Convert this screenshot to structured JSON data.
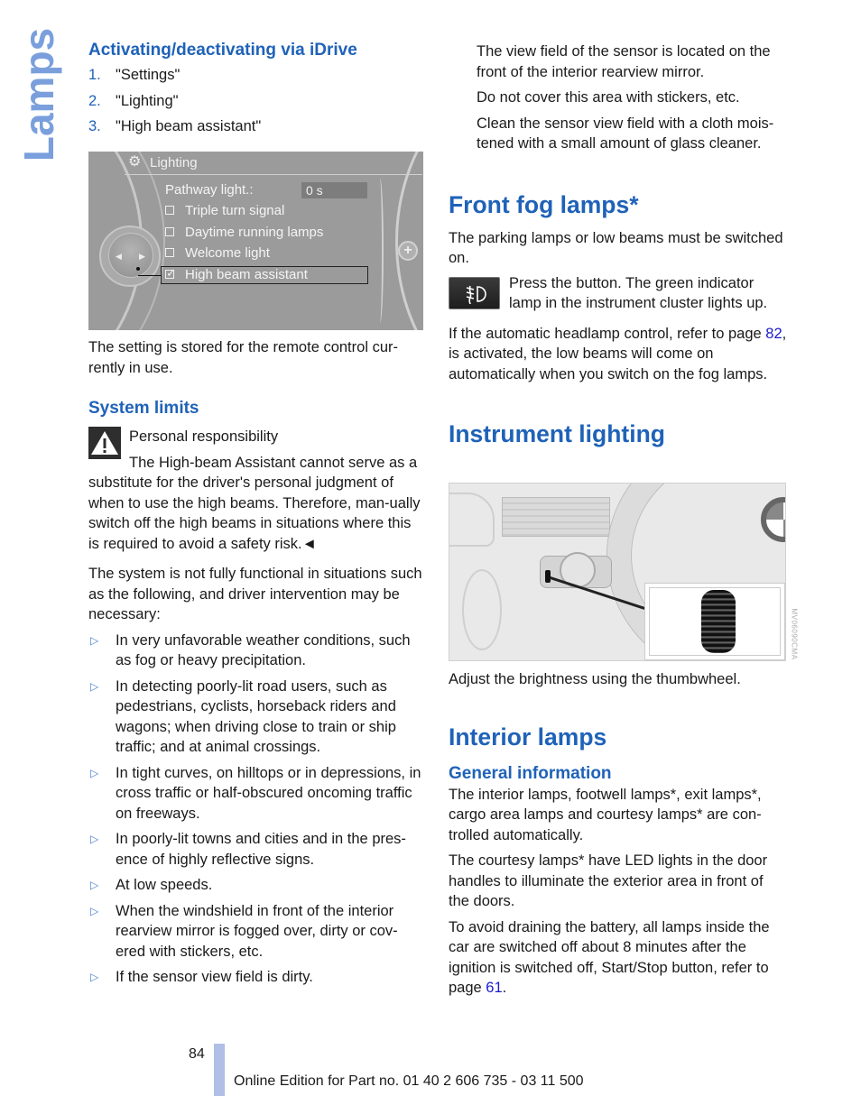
{
  "side_title": "Lamps",
  "left": {
    "idrive_heading": "Activating/deactivating via iDrive",
    "steps": [
      {
        "n": "1.",
        "text": "\"Settings\""
      },
      {
        "n": "2.",
        "text": "\"Lighting\""
      },
      {
        "n": "3.",
        "text": "\"High beam assistant\""
      }
    ],
    "idrive_screen": {
      "title": "Lighting",
      "title_icon": "settings-gear-icon",
      "pathway_label": "Pathway light.:",
      "pathway_value": "0 s",
      "options": [
        {
          "label": "Triple turn signal",
          "checked": false
        },
        {
          "label": "Daytime running lamps",
          "checked": false
        },
        {
          "label": "Welcome light",
          "checked": false
        },
        {
          "label": "High beam assistant",
          "checked": true
        }
      ],
      "controller_left_arrow": "◀",
      "controller_right_arrow": "▶",
      "plus_glyph": "+"
    },
    "stored_text": "The setting is stored for the remote control cur-rently in use.",
    "system_limits_heading": "System limits",
    "warning_title": "Personal responsibility",
    "warning_text": "The High-beam Assistant cannot serve as a substitute for the driver's personal judgment of when to use the high beams. Therefore, man-ually switch off the high beams in situations where this is required to avoid a safety risk.◄",
    "not_functional_text": "The system is not fully functional in situations such as the following, and driver intervention may be necessary:",
    "bullet_glyph": "▷",
    "bullets": [
      "In very unfavorable weather conditions, such as fog or heavy precipitation.",
      "In detecting poorly-lit road users, such as pedestrians, cyclists, horseback riders and wagons; when driving close to train or ship traffic; and at animal crossings.",
      "In tight curves, on hilltops or in depressions, in cross traffic or half-obscured oncoming traffic on freeways.",
      "In poorly-lit towns and cities and in the pres-ence of highly reflective signs.",
      "At low speeds.",
      "When the windshield in front of the interior rearview mirror is fogged over, dirty or cov-ered with stickers, etc.",
      "If the sensor view field is dirty."
    ]
  },
  "right": {
    "sensor_p1": "The view field of the sensor is located on the front of the interior rearview mirror.",
    "sensor_p2": "Do not cover this area with stickers, etc.",
    "sensor_p3": "Clean the sensor view field with a cloth mois-tened with a small amount of glass cleaner.",
    "fog_heading": "Front fog lamps*",
    "fog_p1": "The parking lamps or low beams must be switched on.",
    "fog_button_text": "Press the button. The green indicator lamp in the instrument cluster lights up.",
    "fog_p2_before": "If the automatic headlamp control, refer to page ",
    "fog_p2_link": "82",
    "fog_p2_after": ", is activated, the low beams will come on automatically when you switch on the fog lamps.",
    "instrument_heading": "Instrument lighting",
    "photo_code": "MV06090CMA",
    "instrument_text": "Adjust the brightness using the thumbwheel.",
    "interior_heading": "Interior lamps",
    "general_heading": "General information",
    "interior_p1": "The interior lamps, footwell lamps*, exit lamps*, cargo area lamps and courtesy lamps* are con-trolled automatically.",
    "interior_p2": "The courtesy lamps* have LED lights in the door handles to illuminate the exterior area in front of the doors.",
    "interior_p3_before": "To avoid draining the battery, all lamps inside the car are switched off about 8 minutes after the ignition is switched off, Start/Stop button, refer to page ",
    "interior_p3_link": "61",
    "interior_p3_after": "."
  },
  "footer": {
    "page_number": "84",
    "edition_text": "Online Edition for Part no. 01 40 2 606 735 - 03 11 500"
  },
  "colors": {
    "heading_blue": "#1f62b8",
    "side_title_blue": "#7a9fdc",
    "link_blue": "#1a1acf",
    "footer_bar": "#b1bfe6"
  }
}
